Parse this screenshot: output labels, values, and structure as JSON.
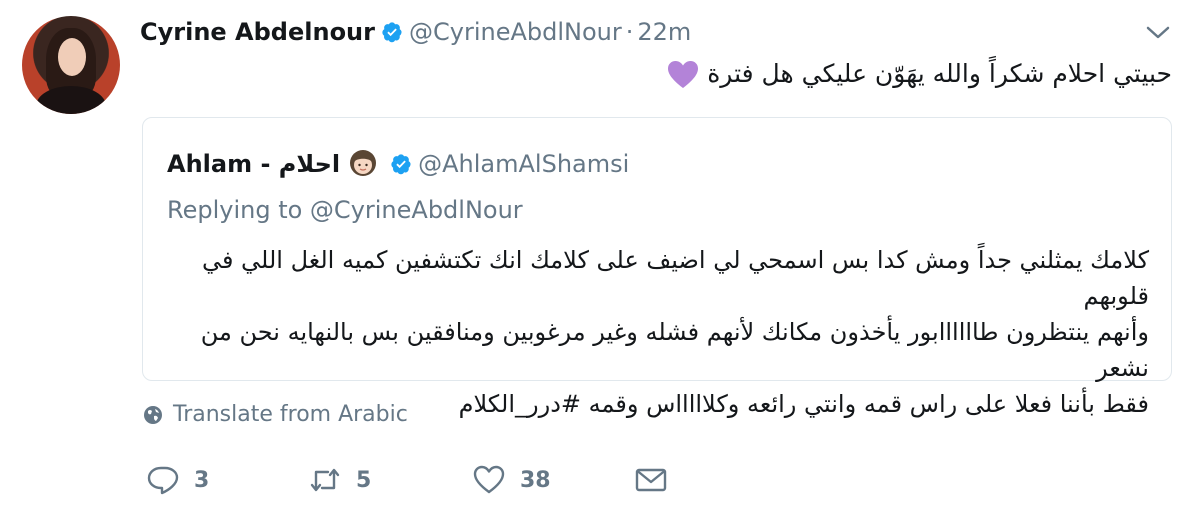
{
  "tweet": {
    "author_name": "Cyrine Abdelnour",
    "author_handle": "@CyrineAbdlNour",
    "separator": "·",
    "time": "22m",
    "text": "حبيتي احلام شكراً والله يهَوّن عليكي هل فترة",
    "emoji": "purple-heart"
  },
  "quoted": {
    "author_name": "Ahlam - احلام",
    "author_handle": "@AhlamAlShamsi",
    "replying_to": "Replying to @CyrineAbdlNour",
    "text_lines": [
      "كلامك يمثلني جداً ومش كدا بس اسمحي لي اضيف على كلامك انك تكتشفين كميه الغل اللي في قلوبهم",
      "وأنهم ينتظرون طاااااابور يأخذون مكانك لأنهم فشله وغير مرغوبين ومنافقين بس بالنهايه نحن من نشعر",
      "فقط بأننا فعلا على راس قمه وانتي رائعه وكلاااااس وقمه #درر_الكلام"
    ]
  },
  "translate_label": "Translate from Arabic",
  "actions": {
    "reply_count": "3",
    "retweet_count": "5",
    "like_count": "38"
  },
  "colors": {
    "verified": "#1da1f2",
    "secondary_text": "#657786",
    "border": "#e1e8ed",
    "purple_heart": "#b383d8"
  }
}
